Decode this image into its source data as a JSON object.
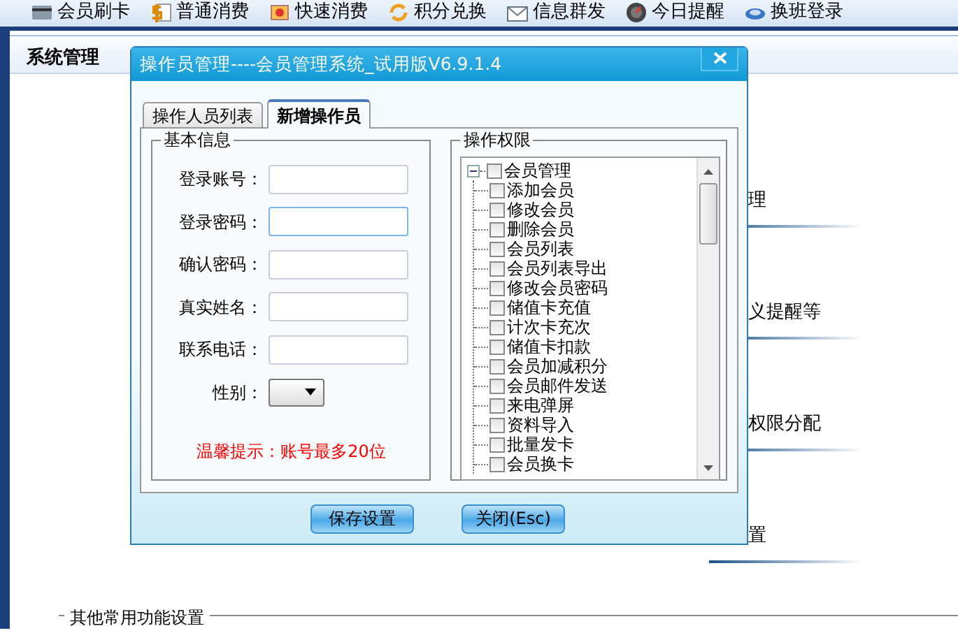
{
  "toolbar": [
    {
      "label": "会员刷卡",
      "kind": "card"
    },
    {
      "label": "普通消费",
      "kind": "dollar"
    },
    {
      "label": "快速消费",
      "kind": "fast"
    },
    {
      "label": "积分兑换",
      "kind": "exchange"
    },
    {
      "label": "信息群发",
      "kind": "mail"
    },
    {
      "label": "今日提醒",
      "kind": "gauge"
    },
    {
      "label": "换班登录",
      "kind": "disk"
    }
  ],
  "panel": {
    "title": "系统管理"
  },
  "background_items": [
    {
      "text": "理"
    },
    {
      "text": "义提醒等"
    },
    {
      "text": "权限分配"
    },
    {
      "text": "置"
    }
  ],
  "bottom_group": {
    "title": "其他常用功能设置"
  },
  "dialog": {
    "title": "操作员管理----会员管理系统_试用版V6.9.1.4",
    "tabs": [
      {
        "label": "操作人员列表",
        "selected": false
      },
      {
        "label": "新增操作员",
        "selected": true
      }
    ],
    "basic_info": {
      "title": "基本信息",
      "fields": [
        {
          "label": "登录账号：",
          "focused": false
        },
        {
          "label": "登录密码：",
          "focused": true
        },
        {
          "label": "确认密码：",
          "focused": false
        },
        {
          "label": "真实姓名：",
          "focused": false
        },
        {
          "label": "联系电话：",
          "focused": false
        }
      ],
      "gender": {
        "label": "性别："
      },
      "hint": "温馨提示：账号最多20位"
    },
    "permissions": {
      "title": "操作权限",
      "tree": [
        {
          "label": "会员管理",
          "checked": false,
          "expanded": true,
          "children": [
            {
              "label": "添加会员",
              "checked": false
            },
            {
              "label": "修改会员",
              "checked": false
            },
            {
              "label": "删除会员",
              "checked": false
            },
            {
              "label": "会员列表",
              "checked": false
            },
            {
              "label": "会员列表导出",
              "checked": false
            },
            {
              "label": "修改会员密码",
              "checked": false
            },
            {
              "label": "储值卡充值",
              "checked": false
            },
            {
              "label": "计次卡充次",
              "checked": false
            },
            {
              "label": "储值卡扣款",
              "checked": false
            },
            {
              "label": "会员加减积分",
              "checked": false
            },
            {
              "label": "会员邮件发送",
              "checked": false
            },
            {
              "label": "来电弹屏",
              "checked": false
            },
            {
              "label": "资料导入",
              "checked": false
            },
            {
              "label": "批量发卡",
              "checked": false
            },
            {
              "label": "会员换卡",
              "checked": false
            }
          ]
        }
      ]
    },
    "buttons": [
      "保存设置",
      "关闭(Esc)"
    ]
  }
}
